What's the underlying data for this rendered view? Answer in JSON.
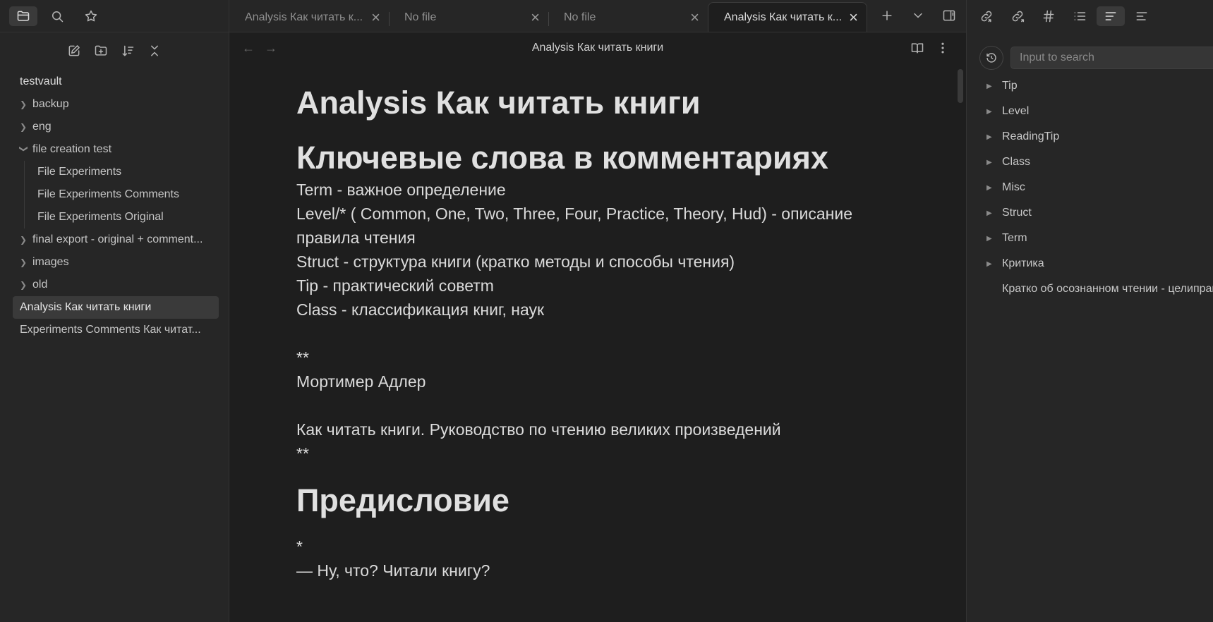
{
  "tabs": [
    {
      "title": "Analysis Как читать к...",
      "active": false
    },
    {
      "title": "No file",
      "active": false
    },
    {
      "title": "No file",
      "active": false
    },
    {
      "title": "Analysis Как читать к...",
      "active": true
    }
  ],
  "sidebar": {
    "vault_name": "testvault",
    "tree": {
      "backup": "backup",
      "eng": "eng",
      "file_creation_test": "file creation test",
      "file_experiments": "File Experiments",
      "file_experiments_comments": "File Experiments Comments",
      "file_experiments_original": "File Experiments Original",
      "final_export": "final export - original + comment...",
      "images": "images",
      "old": "old",
      "analysis_file": "Analysis Как читать книги",
      "experiments_comments_file": "Experiments Comments Как читат..."
    }
  },
  "editor": {
    "view_title": "Analysis Как читать книги",
    "title": "Analysis Как читать книги",
    "h_keywords": "Ключевые слова в комментариях",
    "lines": {
      "term": "Term - важное определение",
      "level_1": "Level/* ( Common, One, Two, Three, Four, Practice, Theory, Hud) - описание",
      "level_2": "правила чтения",
      "struct": "Struct - структура книги (кратко методы и способы чтения)",
      "tip": "Tip - практический советm",
      "class": "Class - классификация книг, наук",
      "stars_1": "**",
      "author": "Мортимер Адлер",
      "book": "Как читать книги. Руководство по чтению великих произведений",
      "stars_2": "**",
      "star": "*",
      "dialog": "— Ну, что? Читали книгу?"
    },
    "h_preface": "Предисловие"
  },
  "outline": {
    "search_placeholder": "Input to search",
    "items": {
      "tip": "Tip",
      "level": "Level",
      "readingtip": "ReadingTip",
      "class": "Class",
      "misc": "Misc",
      "struct": "Struct",
      "term": "Term",
      "critique": "Критика",
      "summary_1": "Кратко об осознанном чтении - цели",
      "summary_2": "правила"
    }
  }
}
